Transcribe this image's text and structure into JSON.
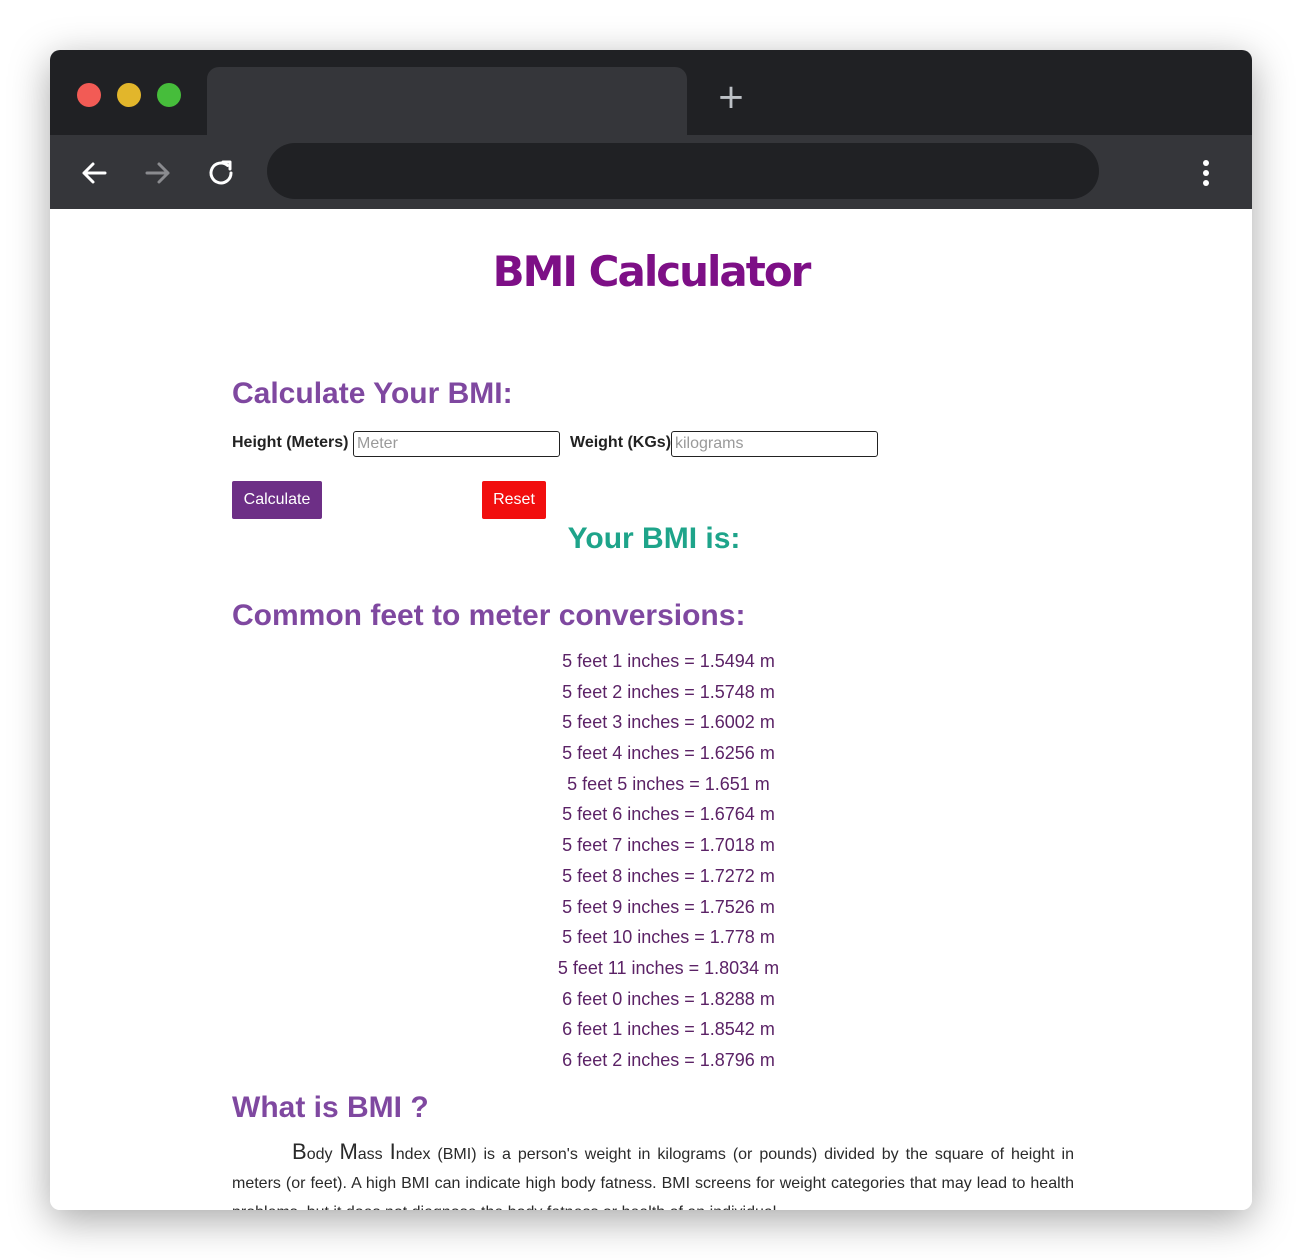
{
  "browser": {
    "new_tab_label": "+"
  },
  "page": {
    "title": "BMI Calculator",
    "calc_heading": "Calculate Your BMI:",
    "height_label": "Height (Meters)",
    "height_placeholder": "Meter",
    "weight_label": "Weight (KGs)",
    "weight_placeholder": "kilograms",
    "calculate_label": "Calculate",
    "reset_label": "Reset",
    "result_heading": "Your BMI is:",
    "conversions_heading": "Common feet to meter conversions:",
    "conversions": [
      "5 feet 1 inches = 1.5494 m",
      "5 feet 2 inches = 1.5748 m",
      "5 feet 3 inches = 1.6002 m",
      "5 feet 4 inches = 1.6256 m",
      "5 feet 5 inches = 1.651 m",
      "5 feet 6 inches = 1.6764 m",
      "5 feet 7 inches = 1.7018 m",
      "5 feet 8 inches = 1.7272 m",
      "5 feet 9 inches = 1.7526 m",
      "5 feet 10 inches = 1.778 m",
      "5 feet 11 inches = 1.8034 m",
      "6 feet 0 inches = 1.8288 m",
      "6 feet 1 inches = 1.8542 m",
      "6 feet 2 inches = 1.8796 m"
    ],
    "what_heading": "What is BMI ?",
    "para": {
      "b": "B",
      "b_rest": "ody ",
      "m": "M",
      "m_rest": "ass ",
      "i": "I",
      "rest": "ndex (BMI) is a person's weight in kilograms (or pounds) divided by the square of height in meters (or feet). A high BMI can indicate high body fatness. BMI screens for weight categories that may lead to health problems, but it does not diagnose the body fatness or health of an individual."
    }
  },
  "colors": {
    "title": "#7d0f86",
    "heading": "#7f48a0",
    "result": "#1ea48a",
    "calculate_button": "#6d2f86",
    "reset_button": "#f10e0e",
    "conversion_text": "#5b2266"
  }
}
